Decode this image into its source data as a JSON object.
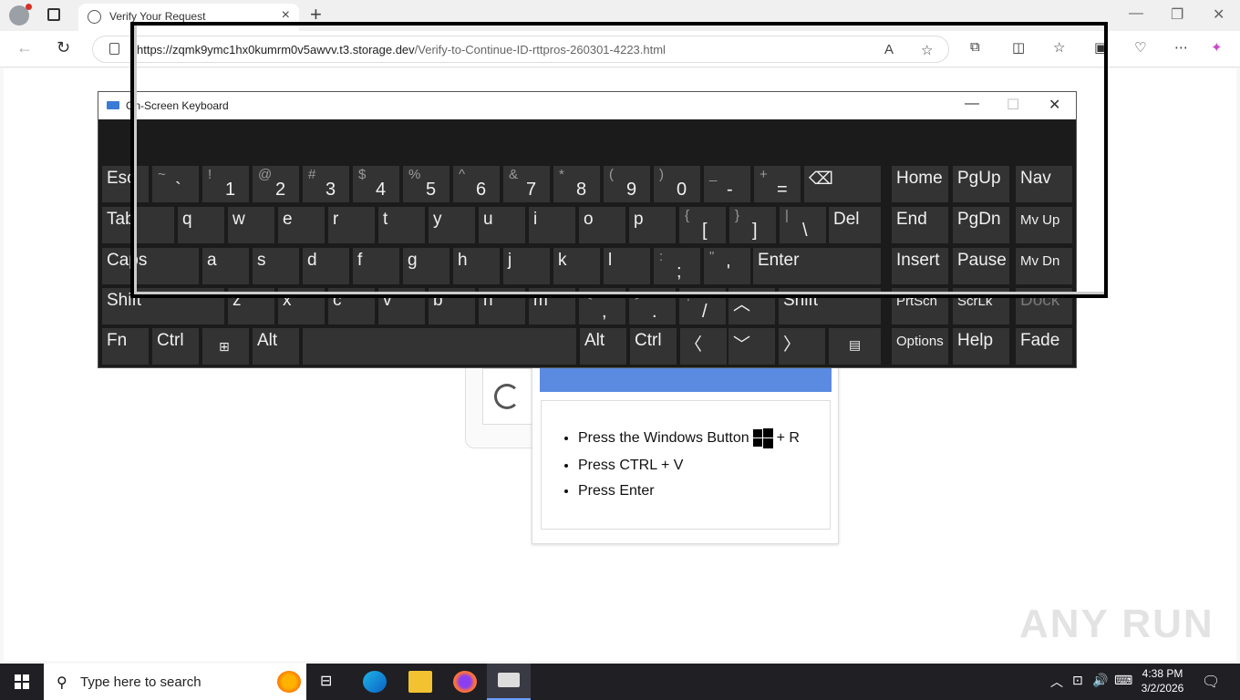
{
  "browser": {
    "tab_title": "Verify Your Request",
    "url_host": "https://zqmk9ymc1hx0kumrm0v5awvv.t3.storage.dev",
    "url_path": "/Verify-to-Continue-ID-rttpros-260301-4223.html"
  },
  "osk": {
    "title": "On-Screen Keyboard",
    "keys": {
      "esc": "Esc",
      "tab": "Tab",
      "caps": "Caps",
      "shift": "Shift",
      "fn": "Fn",
      "ctrl": "Ctrl",
      "alt": "Alt",
      "del": "Del",
      "enter": "Enter",
      "alt_r": "Alt",
      "ctrl_r": "Ctrl",
      "shift_r": "Shift",
      "home": "Home",
      "pgup": "PgUp",
      "nav": "Nav",
      "end": "End",
      "pgdn": "PgDn",
      "mvup": "Mv Up",
      "insert": "Insert",
      "pause": "Pause",
      "mvdn": "Mv Dn",
      "prtscn": "PrtScn",
      "scrlk": "ScrLk",
      "dock": "Dock",
      "options": "Options",
      "help": "Help",
      "fade": "Fade"
    },
    "num_row": [
      [
        "~",
        "`"
      ],
      [
        "!",
        "1"
      ],
      [
        "@",
        "2"
      ],
      [
        "#",
        "3"
      ],
      [
        "$",
        "4"
      ],
      [
        "%",
        "5"
      ],
      [
        "^",
        "6"
      ],
      [
        "&",
        "7"
      ],
      [
        "*",
        "8"
      ],
      [
        "(",
        "9"
      ],
      [
        ")",
        "0"
      ],
      [
        "_",
        "-"
      ],
      [
        "+",
        "="
      ]
    ],
    "q_row": [
      "q",
      "w",
      "e",
      "r",
      "t",
      "y",
      "u",
      "i",
      "o",
      "p"
    ],
    "q_row_sym": [
      [
        "{",
        "["
      ],
      [
        "}",
        "]"
      ],
      [
        "|",
        "\\"
      ]
    ],
    "a_row": [
      "a",
      "s",
      "d",
      "f",
      "g",
      "h",
      "j",
      "k",
      "l"
    ],
    "a_row_sym": [
      [
        ":",
        ";"
      ],
      [
        "\"",
        "'"
      ]
    ],
    "z_row": [
      "z",
      "x",
      "c",
      "v",
      "b",
      "n",
      "m"
    ],
    "z_row_sym": [
      [
        "<",
        ","
      ],
      [
        ">",
        "."
      ],
      [
        "?",
        "/"
      ]
    ]
  },
  "instructions": {
    "step1_prefix": "Press the Windows Button",
    "step1_suffix": "+ R",
    "step2": "Press CTRL + V",
    "step3": "Press Enter"
  },
  "watermark": "ANY RUN",
  "taskbar": {
    "search_placeholder": "Type here to search",
    "time": "4:38 PM",
    "date": "3/2/2026"
  }
}
